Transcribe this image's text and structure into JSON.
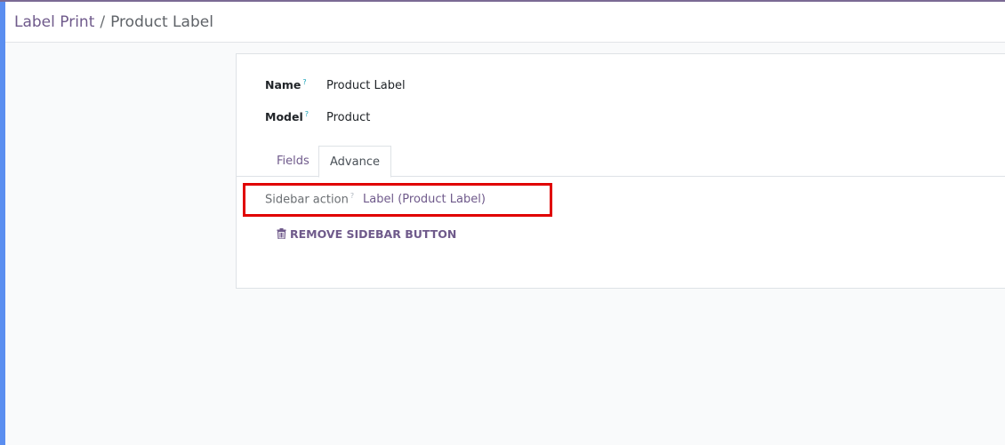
{
  "breadcrumb": {
    "parent": "Label Print",
    "separator": "/",
    "current": "Product Label"
  },
  "form": {
    "name_label": "Name",
    "name_value": "Product Label",
    "model_label": "Model",
    "model_value": "Product",
    "help_mark": "?"
  },
  "tabs": [
    {
      "label": "Fields"
    },
    {
      "label": "Advance"
    }
  ],
  "advance": {
    "sidebar_action_label": "Sidebar action",
    "sidebar_action_value": "Label (Product Label)",
    "remove_button_label": "REMOVE SIDEBAR BUTTON",
    "remove_icon": "trash-icon"
  },
  "colors": {
    "accent": "#6f5a8b",
    "highlight": "#e00000",
    "left_edge": "#5b8ef0"
  }
}
